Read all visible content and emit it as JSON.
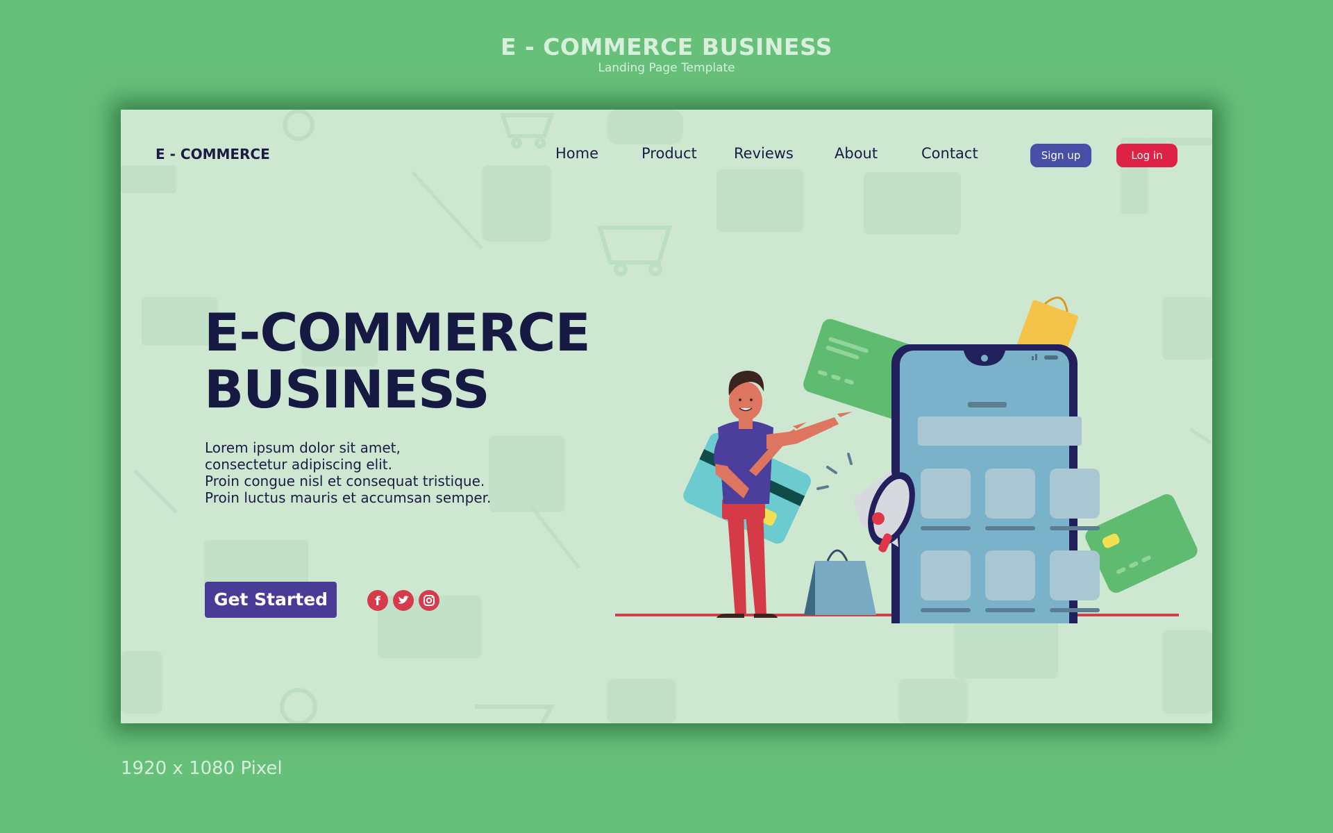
{
  "frame": {
    "title": "E - COMMERCE BUSINESS",
    "subtitle": "Landing Page Template",
    "footer": "1920 x 1080 Pixel"
  },
  "header": {
    "brand": "E - COMMERCE",
    "nav": [
      "Home",
      "Product",
      "Reviews",
      "About",
      "Contact"
    ],
    "signup_label": "Sign up",
    "login_label": "Log in"
  },
  "hero": {
    "title_line1": "E-COMMERCE",
    "title_line2": "BUSINESS",
    "body": [
      "Lorem ipsum dolor sit amet,",
      "consectetur adipiscing elit.",
      "Proin congue nisl et consequat tristique.",
      "Proin luctus mauris et accumsan semper."
    ],
    "cta_label": "Get Started"
  },
  "social": [
    "facebook-icon",
    "twitter-icon",
    "instagram-icon"
  ],
  "colors": {
    "frame_bg": "#67c07a",
    "page_bg": "#cde7d1",
    "heading": "#161942",
    "cta": "#483c97",
    "signup": "#4750a6",
    "login": "#dd2246",
    "social": "#d63b4b"
  }
}
